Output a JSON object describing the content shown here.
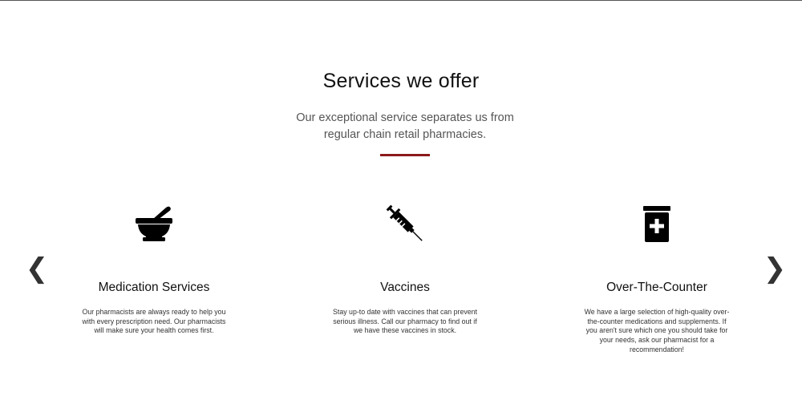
{
  "section": {
    "title": "Services we offer",
    "subtitle": "Our exceptional service separates us from regular chain retail pharmacies."
  },
  "colors": {
    "accent": "#8b1a1a",
    "icon": "#000000",
    "text": "#111111"
  },
  "carousel": {
    "prev_label": "❮",
    "next_label": "❯"
  },
  "services": [
    {
      "icon": "mortar-pestle-icon",
      "title": "Medication Services",
      "description": "Our pharmacists are always ready to help you with every prescription need. Our pharmacists will make sure your health comes first."
    },
    {
      "icon": "syringe-icon",
      "title": "Vaccines",
      "description": "Stay up-to date with vaccines that can prevent serious illness. Call our pharmacy to find out if we have these vaccines in stock."
    },
    {
      "icon": "prescription-bottle-icon",
      "title": "Over-The-Counter",
      "description": "We have a large selection of high-quality over-the-counter medications and supplements. If you aren't sure which one you should take for your needs, ask our pharmacist for a recommendation!"
    }
  ]
}
